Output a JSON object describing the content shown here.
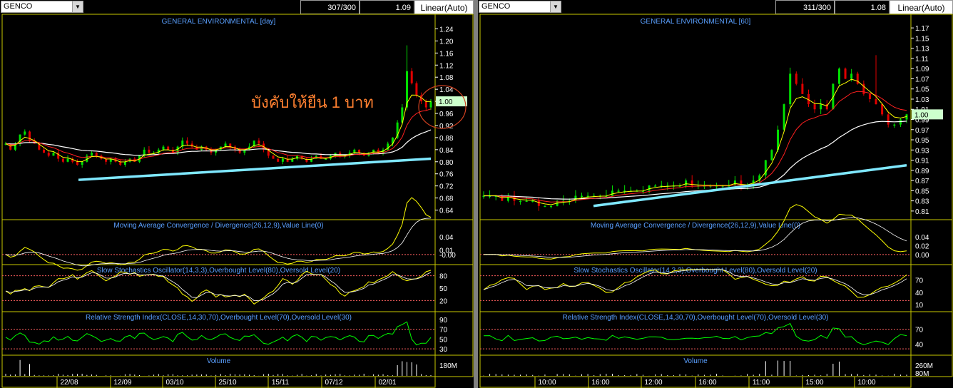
{
  "charts": [
    {
      "symbol": "GENCO",
      "count": "307/300",
      "last": "1.09",
      "scale": "Linear(Auto)",
      "title": "GENERAL ENVIRONMENTAL [day]",
      "annotation": "บังคับให้ยืน 1 บาท",
      "current_price": "1.00",
      "price_ticks": [
        "1.24",
        "1.20",
        "1.16",
        "1.12",
        "1.08",
        "1.04",
        "1.00",
        "0.96",
        "0.92",
        "0.88",
        "0.84",
        "0.80",
        "0.76",
        "0.72",
        "0.68",
        "0.64"
      ],
      "x_labels": [
        "22/08",
        "12/09",
        "03/10",
        "25/10",
        "15/11",
        "07/12",
        "02/01"
      ],
      "macd_title": "Moving Average Convergence / Divergence(26,12,9),Value Line(0)",
      "macd_ticks": [
        "0.04",
        "0.01",
        "-0.00"
      ],
      "stoch_title": "Slow Stochastics Oscillator(14,3,3),Overbought Level(80),Oversold Level(20)",
      "stoch_ticks": [
        "80",
        "50",
        "20"
      ],
      "rsi_title": "Relative Strength Index(CLOSE,14,30,70),Overbought Level(70),Oversold Level(30)",
      "rsi_ticks": [
        "90",
        "70",
        "50",
        "30"
      ],
      "volume_title": "Volume",
      "volume_ticks": [
        "180M"
      ]
    },
    {
      "symbol": "GENCO",
      "count": "311/300",
      "last": "1.08",
      "scale": "Linear(Auto)",
      "title": "GENERAL ENVIRONMENTAL [60]",
      "annotation": "",
      "current_price": "1.00",
      "price_ticks": [
        "1.17",
        "1.15",
        "1.13",
        "1.11",
        "1.09",
        "1.07",
        "1.05",
        "1.03",
        "1.01",
        "0.99",
        "0.97",
        "0.95",
        "0.93",
        "0.91",
        "0.89",
        "0.87",
        "0.85",
        "0.83",
        "0.81"
      ],
      "x_labels": [
        "10:00",
        "16:00",
        "12:00",
        "16:00",
        "11:00",
        "15:00",
        "10:00"
      ],
      "macd_title": "Moving Average Convergence / Divergence(26,12,9),Value Line(0)",
      "macd_ticks": [
        "0.04",
        "0.02",
        "0.00"
      ],
      "stoch_title": "Slow Stochastics Oscillator(14,3,3),Overbought Level(80),Oversold Level(20)",
      "stoch_ticks": [
        "70",
        "40",
        "10"
      ],
      "rsi_title": "Relative Strength Index(CLOSE,14,30,70),Overbought Level(70),Oversold Level(30)",
      "rsi_ticks": [
        "70",
        "40"
      ],
      "volume_title": "Volume",
      "volume_ticks": [
        "260M",
        "80M"
      ]
    }
  ],
  "chart_data": [
    {
      "type": "candlestick",
      "title": "GENERAL ENVIRONMENTAL [day]",
      "ylim": [
        0.62,
        1.26
      ],
      "close_path": [
        0.86,
        0.84,
        0.86,
        0.89,
        0.9,
        0.87,
        0.86,
        0.84,
        0.83,
        0.82,
        0.83,
        0.81,
        0.8,
        0.81,
        0.8,
        0.79,
        0.8,
        0.82,
        0.83,
        0.82,
        0.81,
        0.8,
        0.81,
        0.8,
        0.79,
        0.8,
        0.81,
        0.8,
        0.82,
        0.84,
        0.83,
        0.83,
        0.84,
        0.85,
        0.84,
        0.83,
        0.85,
        0.87,
        0.86,
        0.85,
        0.84,
        0.85,
        0.84,
        0.83,
        0.84,
        0.85,
        0.86,
        0.85,
        0.84,
        0.83,
        0.84,
        0.85,
        0.87,
        0.86,
        0.84,
        0.82,
        0.81,
        0.8,
        0.81,
        0.8,
        0.81,
        0.82,
        0.81,
        0.8,
        0.81,
        0.82,
        0.81,
        0.81,
        0.82,
        0.83,
        0.82,
        0.82,
        0.83,
        0.84,
        0.83,
        0.82,
        0.83,
        0.84,
        0.83,
        0.84,
        0.86,
        0.88,
        0.93,
        0.98,
        1.1,
        1.06,
        1.02,
        1.0,
        0.98,
        1.0
      ],
      "ema_fast_end": 0.99,
      "ema_slow_end": 0.93,
      "sma_long_end": 0.86,
      "sma_200_range": [
        0.74,
        0.81
      ],
      "macd_range": [
        -0.01,
        0.05
      ],
      "stoch_levels": [
        80,
        20
      ],
      "rsi_levels": [
        70,
        30
      ],
      "volume_max": "180M"
    },
    {
      "type": "candlestick",
      "title": "GENERAL ENVIRONMENTAL [60]",
      "ylim": [
        0.8,
        1.18
      ],
      "close_path": [
        0.84,
        0.84,
        0.84,
        0.83,
        0.84,
        0.83,
        0.83,
        0.83,
        0.83,
        0.82,
        0.82,
        0.82,
        0.83,
        0.83,
        0.83,
        0.84,
        0.84,
        0.84,
        0.84,
        0.84,
        0.84,
        0.85,
        0.85,
        0.85,
        0.85,
        0.85,
        0.85,
        0.86,
        0.86,
        0.86,
        0.86,
        0.86,
        0.86,
        0.87,
        0.86,
        0.86,
        0.86,
        0.86,
        0.86,
        0.86,
        0.86,
        0.87,
        0.86,
        0.86,
        0.87,
        0.88,
        0.91,
        0.93,
        0.97,
        1.02,
        1.08,
        1.06,
        1.04,
        1.02,
        1.01,
        1.02,
        1.01,
        1.06,
        1.09,
        1.07,
        1.08,
        1.06,
        1.04,
        1.03,
        1.02,
        1.0,
        0.98,
        0.98,
        0.99,
        1.0
      ],
      "ema_fast_end": 1.0,
      "ema_slow_end": 1.0,
      "sma_long_end": 0.97,
      "sma_200_range": [
        0.82,
        0.9
      ],
      "macd_range": [
        -0.01,
        0.05
      ],
      "stoch_levels": [
        80,
        20
      ],
      "rsi_levels": [
        70,
        30
      ],
      "volume_max": "260M"
    }
  ]
}
